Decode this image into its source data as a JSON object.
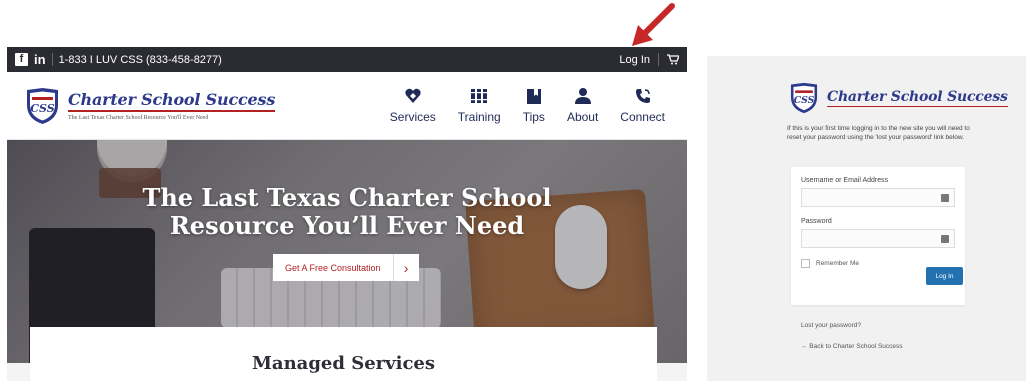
{
  "site": {
    "topbar": {
      "facebook_glyph": "f",
      "linkedin_label": "in",
      "phone": "1-833 I LUV CSS (833-458-8277)",
      "login_label": "Log In",
      "cart_icon": "cart-icon"
    },
    "brand": {
      "shield_text": "CSS",
      "name": "Charter School Success",
      "tagline": "The Last Texas Charter School Resource You'll Ever Need"
    },
    "nav": [
      {
        "label": "Services",
        "icon": "heart-diamond-icon"
      },
      {
        "label": "Training",
        "icon": "books-icon"
      },
      {
        "label": "Tips",
        "icon": "bookmark-icon"
      },
      {
        "label": "About",
        "icon": "user-icon"
      },
      {
        "label": "Connect",
        "icon": "phone-icon"
      }
    ],
    "hero": {
      "line1": "The Last Texas Charter School",
      "line2": "Resource You’ll Ever Need",
      "cta_label": "Get A Free Consultation",
      "cta_arrow": "›"
    },
    "section_title": "Managed Services"
  },
  "login": {
    "brand_name": "Charter School Success",
    "shield_text": "CSS",
    "notice": "If this is your first time logging in to the new site you will need to reset your password using the 'lost your password' link below.",
    "username_label": "Username or Email Address",
    "password_label": "Password",
    "remember_label": "Remember Me",
    "submit_label": "Log In",
    "lost_password": "Lost your password?",
    "back_link": "← Back to Charter School Success"
  },
  "colors": {
    "brand_blue": "#2d3a8c",
    "brand_red": "#b22222",
    "topbar": "#2b2b33",
    "wp_button": "#2271b1",
    "annotation_arrow": "#c62828"
  }
}
